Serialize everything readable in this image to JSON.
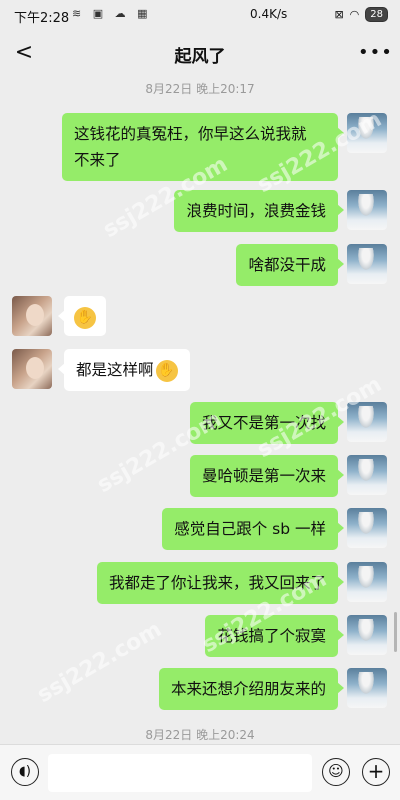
{
  "status_bar": {
    "time": "下午2:28",
    "network_speed": "0.4K/s",
    "battery_level": "28"
  },
  "header": {
    "title": "起风了"
  },
  "timestamps": [
    "8月22日 晚上20:17",
    "8月22日 晚上20:24"
  ],
  "messages": [
    {
      "sender": "me",
      "text": "这钱花的真冤枉，你早这么说我就\n不来了"
    },
    {
      "sender": "me",
      "text": "浪费时间，浪费金钱"
    },
    {
      "sender": "me",
      "text": "啥都没干成"
    },
    {
      "sender": "friend",
      "text": "",
      "emoji": "facepalm-emoji"
    },
    {
      "sender": "friend",
      "text": "都是这样啊",
      "emoji": "facepalm-emoji"
    },
    {
      "sender": "me",
      "text": "我又不是第一次找"
    },
    {
      "sender": "me",
      "text": "曼哈顿是第一次来"
    },
    {
      "sender": "me",
      "text": "感觉自己跟个 sb 一样"
    },
    {
      "sender": "me",
      "text": "我都走了你让我来，我又回来了"
    },
    {
      "sender": "me",
      "text": "花钱搞了个寂寞"
    },
    {
      "sender": "me",
      "text": "本来还想介绍朋友来的"
    }
  ],
  "watermark": "ssj222.com",
  "colors": {
    "background": "#ededed",
    "my_bubble": "#95ec69",
    "friend_bubble": "#ffffff",
    "timestamp_text": "#9a9a9a"
  }
}
